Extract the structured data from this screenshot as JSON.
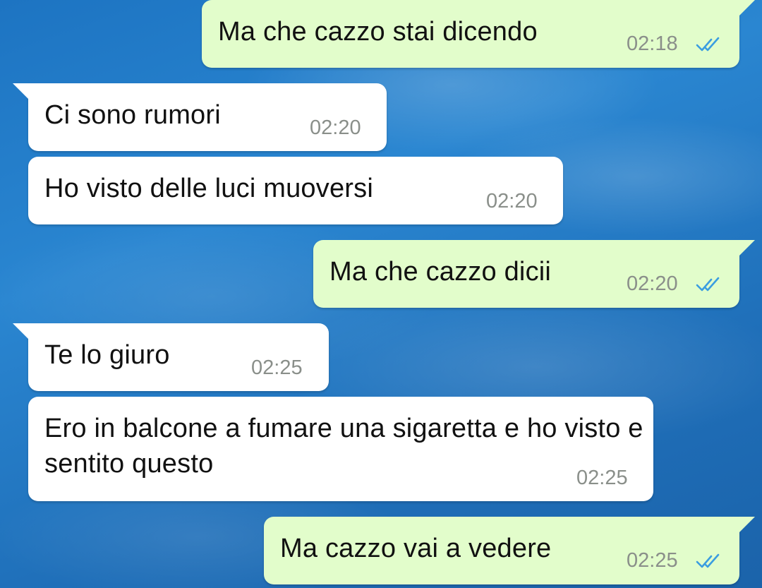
{
  "messages": [
    {
      "direction": "outgoing",
      "text": "Ma che cazzo stai dicendo",
      "time": "02:18",
      "status": "read",
      "status_icon": "double-check-read-icon",
      "status_color": "#3b9de0"
    },
    {
      "direction": "incoming",
      "text": "Ci sono rumori",
      "time": "02:20"
    },
    {
      "direction": "incoming",
      "text": "Ho visto delle luci muoversi",
      "time": "02:20"
    },
    {
      "direction": "outgoing",
      "text": "Ma che cazzo dicii",
      "time": "02:20",
      "status": "read",
      "status_icon": "double-check-read-icon",
      "status_color": "#3b9de0"
    },
    {
      "direction": "incoming",
      "text": "Te lo giuro",
      "time": "02:25"
    },
    {
      "direction": "incoming",
      "text": "Ero in balcone a fumare una sigaretta e ho visto e sentito questo",
      "time": "02:25"
    },
    {
      "direction": "outgoing",
      "text": "Ma cazzo vai a vedere",
      "time": "02:25",
      "status": "read",
      "status_icon": "double-check-read-icon",
      "status_color": "#3b9de0"
    }
  ],
  "colors": {
    "outgoing_bubble": "#e2fdcb",
    "incoming_bubble": "#ffffff",
    "timestamp": "#8a8f8a",
    "read_ticks": "#3b9de0",
    "wallpaper": "#1f6fb9"
  }
}
